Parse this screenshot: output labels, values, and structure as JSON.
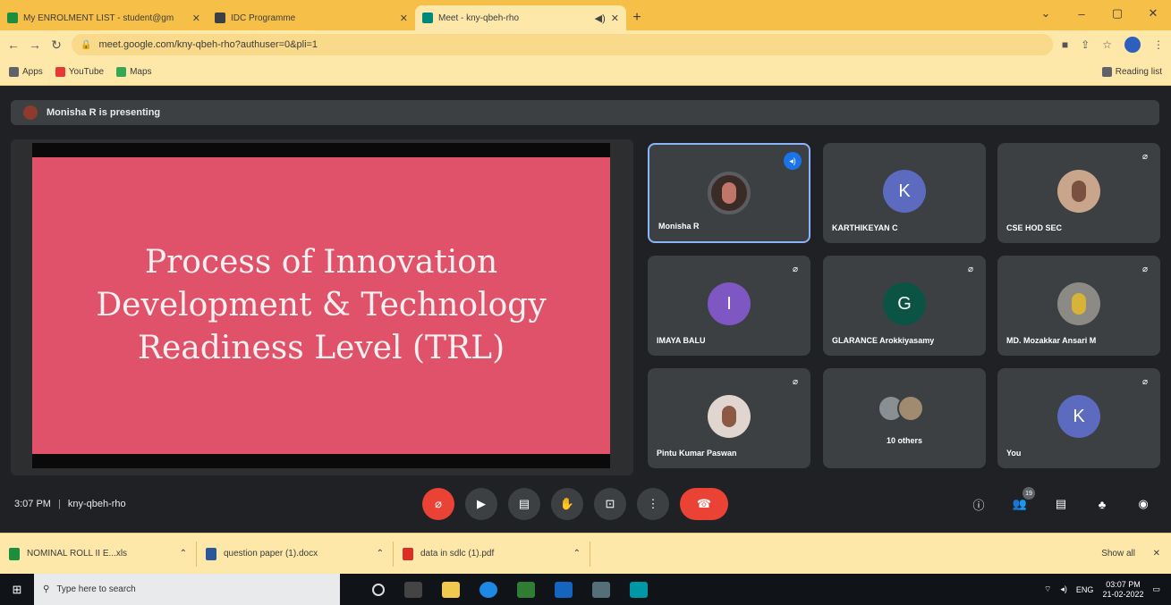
{
  "browser": {
    "tabs": [
      {
        "title": "My ENROLMENT LIST - student@gm",
        "favicon_color": "#1e8e3e"
      },
      {
        "title": "IDC Programme",
        "favicon_color": "#3c4043"
      },
      {
        "title": "Meet - kny-qbeh-rho",
        "favicon_color": "#00897b"
      }
    ],
    "new_tab": "+",
    "window_controls": [
      "⌄",
      "–",
      "▢",
      "✕"
    ],
    "url": "meet.google.com/kny-qbeh-rho?authuser=0&pli=1",
    "bookmarks": [
      {
        "label": "Apps",
        "color": "#5f6368"
      },
      {
        "label": "YouTube",
        "color": "#e53935"
      },
      {
        "label": "Maps",
        "color": "#34a853"
      }
    ],
    "reading_list": "Reading list"
  },
  "meet": {
    "presenting_text": "Monisha R is presenting",
    "slide_title": "Process of Innovation Development & Technology Readiness Level (TRL)",
    "participants": [
      {
        "name": "Monisha R",
        "avatar": "photo",
        "letter": ""
      },
      {
        "name": "KARTHIKEYAN C",
        "avatar": "letter",
        "letter": "K"
      },
      {
        "name": "CSE HOD SEC",
        "avatar": "photo",
        "letter": ""
      },
      {
        "name": "IMAYA BALU",
        "avatar": "letter",
        "letter": "I"
      },
      {
        "name": "GLARANCE Arokkiyasamy",
        "avatar": "letter",
        "letter": "G"
      },
      {
        "name": "MD. Mozakkar Ansari M",
        "avatar": "photo",
        "letter": ""
      },
      {
        "name": "Pintu Kumar Paswan",
        "avatar": "photo",
        "letter": ""
      },
      {
        "name": "10 others",
        "avatar": "cluster",
        "letter": ""
      },
      {
        "name": "You",
        "avatar": "letter",
        "letter": "K"
      }
    ],
    "time": "3:07 PM",
    "meeting_code": "kny-qbeh-rho",
    "participant_count": "19"
  },
  "downloads": {
    "items": [
      {
        "name": "NOMINAL ROLL II E...xls",
        "color": "#1e8e3e"
      },
      {
        "name": "question paper (1).docx",
        "color": "#2b579a"
      },
      {
        "name": "data in sdlc (1).pdf",
        "color": "#d93025"
      }
    ],
    "show_all": "Show all"
  },
  "taskbar": {
    "search_placeholder": "Type here to search",
    "app_colors": [
      "#f2c94c",
      "#1e88e5",
      "#2e7d32",
      "#1565c0",
      "#546e7a",
      "#0097a7"
    ],
    "lang": "ENG",
    "clock_time": "03:07 PM",
    "clock_date": "21-02-2022"
  },
  "colors": {
    "meet_bg": "#202124",
    "tile_bg": "#3c4043",
    "slide_bg": "#e0516a",
    "hangup": "#ea4335",
    "active_border": "#8ab4f8"
  }
}
